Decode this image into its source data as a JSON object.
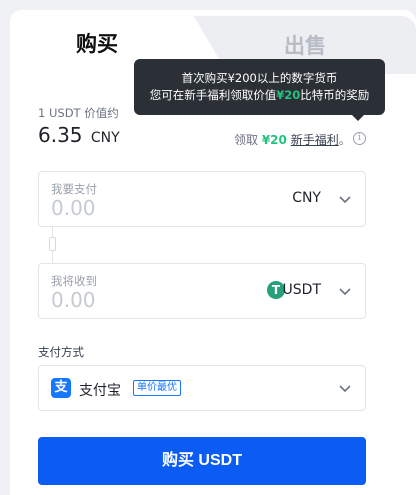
{
  "tabs": {
    "buy": "购买",
    "sell": "出售"
  },
  "tooltip": {
    "line1": "首次购买¥200以上的数字货币",
    "line2_pre": "您可在新手福利领取价值",
    "line2_amount": "¥20",
    "line2_post": "比特币的奖励"
  },
  "price": {
    "label": "1 USDT 价值约",
    "value": "6.35",
    "unit": "CNY"
  },
  "reward": {
    "pre": "领取 ",
    "amount": "¥20",
    "link": "新手福利",
    "post": "。",
    "info_icon": "i"
  },
  "pay": {
    "label": "我要支付",
    "placeholder": "0.00",
    "currency": "CNY"
  },
  "receive": {
    "label": "我将收到",
    "placeholder": "0.00",
    "currency": "USDT",
    "currency_icon": "T"
  },
  "payment_method": {
    "label": "支付方式",
    "name": "支付宝",
    "badge": "单价最优",
    "icon": "支"
  },
  "buy_button": "购买 USDT",
  "colors": {
    "primary": "#0a5cf5",
    "green": "#22c37f",
    "tooltip_bg": "#2b2f36",
    "alipay": "#1677ff",
    "usdt": "#26a17b"
  }
}
